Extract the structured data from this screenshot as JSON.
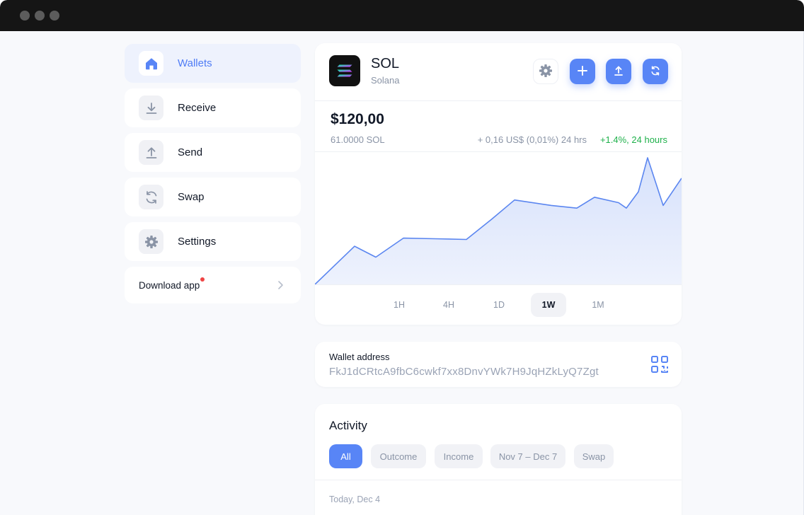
{
  "sidebar": {
    "items": [
      {
        "label": "Wallets",
        "icon": "home-icon",
        "active": true
      },
      {
        "label": "Receive",
        "icon": "download-icon",
        "active": false
      },
      {
        "label": "Send",
        "icon": "upload-icon",
        "active": false
      },
      {
        "label": "Swap",
        "icon": "refresh-icon",
        "active": false
      },
      {
        "label": "Settings",
        "icon": "gear-icon",
        "active": false
      }
    ],
    "download_label": "Download app"
  },
  "coin": {
    "symbol": "SOL",
    "name": "Solana",
    "balance": "$120,00",
    "amount": "61.0000 SOL",
    "change_usd": "+ 0,16 US$ (0,01%) 24 hrs",
    "change_pct": "+1.4%, 24 hours",
    "ranges": [
      "1H",
      "4H",
      "1D",
      "1W",
      "1M"
    ],
    "active_range": "1W"
  },
  "chart_data": {
    "type": "area",
    "x": [
      0,
      1,
      2,
      3,
      4,
      5,
      6,
      7,
      8,
      9,
      10,
      11,
      12,
      13,
      14,
      15,
      16
    ],
    "values": [
      0,
      28,
      20,
      34,
      33.5,
      33,
      48,
      62,
      58,
      56,
      64,
      60,
      56,
      68,
      93,
      58,
      78,
      86
    ],
    "color": "#5b86f0"
  },
  "wallet": {
    "label": "Wallet address",
    "address": "FkJ1dCRtcA9fbC6cwkf7xx8DnvYWk7H9JqHZkLyQ7Zgt"
  },
  "activity": {
    "title": "Activity",
    "filters": [
      "All",
      "Outcome",
      "Income",
      "Nov 7 – Dec 7",
      "Swap"
    ],
    "active_filter": "All",
    "date_header": "Today, Dec 4"
  },
  "colors": {
    "accent": "#5885f6",
    "positive": "#1fb14b",
    "notification": "#ef4444"
  }
}
